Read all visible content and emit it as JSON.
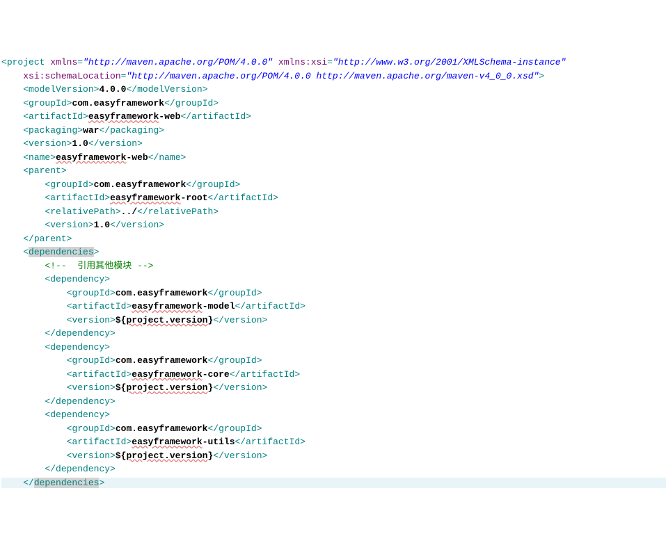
{
  "xml": {
    "root": {
      "tag": "project",
      "xmlns": "xmlns",
      "xmlns_val": "\"http://maven.apache.org/POM/4.0.0\"",
      "xsi": "xmlns:xsi",
      "xsi_val": "\"http://www.w3.org/2001/XMLSchema-instance\"",
      "schemaLoc": "xsi:schemaLocation",
      "schemaLoc_val": "\"http://maven.apache.org/POM/4.0.0 http://maven.apache.org/maven-v4_0_0.xsd\""
    },
    "modelVersion": {
      "open": "modelVersion",
      "val": "4.0.0",
      "close": "modelVersion"
    },
    "groupId1": {
      "open": "groupId",
      "val": "com.easyframework",
      "close": "groupId"
    },
    "artifactId1": {
      "open": "artifactId",
      "val1": "easyframework",
      "val2": "-web",
      "close": "artifactId"
    },
    "packaging": {
      "open": "packaging",
      "val": "war",
      "close": "packaging"
    },
    "version1": {
      "open": "version",
      "val": "1.0",
      "close": "version"
    },
    "name": {
      "open": "name",
      "val1": "easyframework",
      "val2": "-web",
      "close": "name"
    },
    "parent": {
      "open": "parent",
      "close": "parent",
      "groupId": {
        "open": "groupId",
        "val": "com.easyframework",
        "close": "groupId"
      },
      "artifactId": {
        "open": "artifactId",
        "val1": "easyframework",
        "val2": "-root",
        "close": "artifactId"
      },
      "relativePath": {
        "open": "relativePath",
        "val": "../",
        "close": "relativePath"
      },
      "version": {
        "open": "version",
        "val": "1.0",
        "close": "version"
      }
    },
    "dependencies": {
      "open": "dependencies",
      "close": "dependencies",
      "comment": "!--  引用其他模块 --",
      "dep1": {
        "open": "dependency",
        "close": "dependency",
        "groupId": {
          "open": "groupId",
          "val": "com.easyframework",
          "close": "groupId"
        },
        "artifactId": {
          "open": "artifactId",
          "val1": "easyframework",
          "val2": "-model",
          "close": "artifactId"
        },
        "version": {
          "open": "version",
          "val1": "${",
          "val2": "project.version",
          "val3": "}",
          "close": "version"
        }
      },
      "dep2": {
        "open": "dependency",
        "close": "dependency",
        "groupId": {
          "open": "groupId",
          "val": "com.easyframework",
          "close": "groupId"
        },
        "artifactId": {
          "open": "artifactId",
          "val1": "easyframework",
          "val2": "-core",
          "close": "artifactId"
        },
        "version": {
          "open": "version",
          "val1": "${",
          "val2": "project.version",
          "val3": "}",
          "close": "version"
        }
      },
      "dep3": {
        "open": "dependency",
        "close": "dependency",
        "groupId": {
          "open": "groupId",
          "val": "com.easyframework",
          "close": "groupId"
        },
        "artifactId": {
          "open": "artifactId",
          "val1": "easyframework",
          "val2": "-utils",
          "close": "artifactId"
        },
        "version": {
          "open": "version",
          "val1": "${",
          "val2": "project.version",
          "val3": "}",
          "close": "version"
        }
      }
    }
  }
}
